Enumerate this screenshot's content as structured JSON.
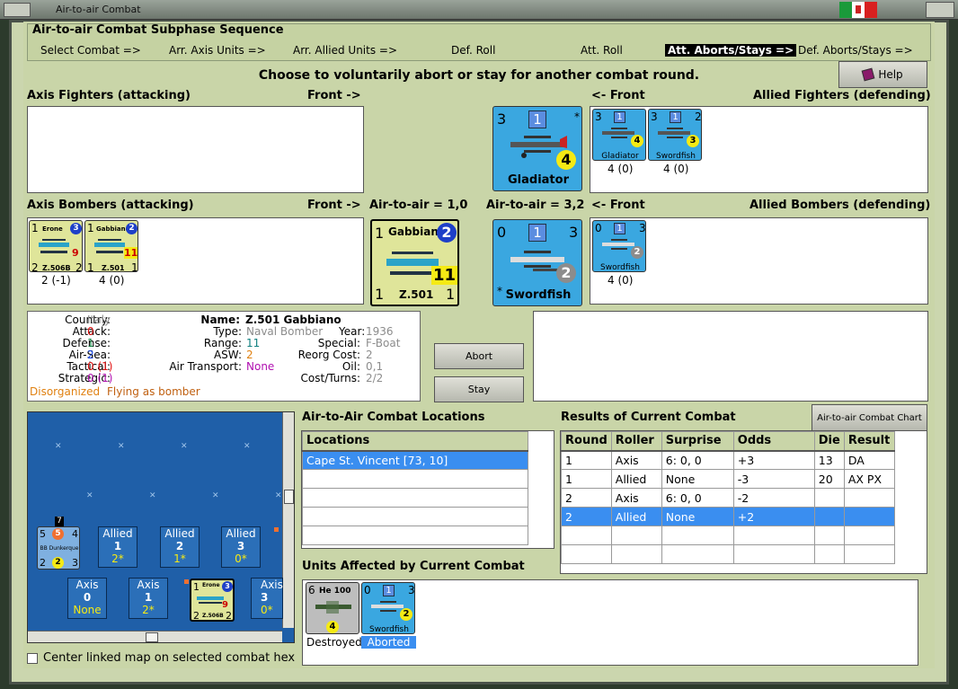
{
  "window": {
    "title": "Air-to-air Combat"
  },
  "phase": {
    "title": "Air-to-air Combat Subphase Sequence",
    "steps": [
      "Select Combat =>",
      "Arr. Axis Units =>",
      "Arr. Allied Units =>",
      "Def. Roll",
      "Att. Roll",
      "Att. Aborts/Stays =>",
      "Def. Aborts/Stays =>"
    ],
    "active_index": 5
  },
  "instruction": "Choose to voluntarily abort or stay for another combat round.",
  "help_label": "Help",
  "labels": {
    "axis_fighters": "Axis Fighters (attacking)",
    "front_right": "Front ->",
    "front_left": "<- Front",
    "allied_fighters": "Allied Fighters (defending)",
    "axis_bombers": "Axis Bombers (attacking)",
    "allied_bombers": "Allied Bombers (defending)",
    "air_axis": "Air-to-air = 1,0",
    "air_allied": "Air-to-air = 3,2"
  },
  "units": {
    "gladiator_big": {
      "att": "3",
      "def": "1",
      "val": "4",
      "name": "Gladiator",
      "star": "*"
    },
    "gladiator_small": {
      "att": "3",
      "def": "1",
      "val": "4",
      "name": "Gladiator",
      "status": "4 (0)"
    },
    "swordfish_fighter_small": {
      "att": "3",
      "def": "1",
      "top": "2",
      "val": "3",
      "name": "Swordfish",
      "status": "4 (0)"
    },
    "erone": {
      "name": "Erone",
      "model": "Z.506B",
      "l1": "1",
      "l2": "2",
      "r2": "2",
      "circ": "3",
      "val": "9",
      "status": "2 (-1)"
    },
    "gabbiano_small": {
      "name": "Gabbiano",
      "model": "Z.501",
      "l1": "1",
      "l2": "1",
      "r2": "1",
      "circ": "2",
      "val": "11",
      "status": "4 (0)"
    },
    "gabbiano_big": {
      "name": "Gabbiano",
      "model": "Z.501",
      "l1": "1",
      "l2": "1",
      "r2": "1",
      "circ": "2",
      "val": "11"
    },
    "swordfish_big": {
      "att": "0",
      "def": "1",
      "top": "3",
      "val": "2",
      "name": "Swordfish",
      "star": "*"
    },
    "swordfish_bomber_small": {
      "att": "0",
      "def": "1",
      "top": "3",
      "val": "2",
      "name": "Swordfish",
      "status": "4 (0)"
    }
  },
  "info": {
    "country_label": "Country:",
    "country": "Italy",
    "attack_label": "Attack:",
    "attack": "0",
    "defense_label": "Defense:",
    "defense": "1",
    "airsea_label": "Air-Sea:",
    "airsea": "2",
    "tactical_label": "Tactical:",
    "tactical": "0 (1)",
    "strategic_label": "Strategic:",
    "strategic": "0 (1)",
    "status_a": "Disorganized",
    "status_b": "Flying as bomber",
    "name_label": "Name:",
    "name": "Z.501 Gabbiano",
    "type_label": "Type:",
    "type": "Naval Bomber",
    "year_label": "Year:",
    "year": "1936",
    "range_label": "Range:",
    "range": "11",
    "special_label": "Special:",
    "special": "F-Boat",
    "asw_label": "ASW:",
    "asw": "2",
    "reorg_label": "Reorg Cost:",
    "reorg": "2",
    "airtransport_label": "Air Transport:",
    "airtransport": "None",
    "oil_label": "Oil:",
    "oil": "0,1",
    "costturns_label": "Cost/Turns:",
    "costturns": "2/2"
  },
  "buttons": {
    "abort": "Abort",
    "stay": "Stay",
    "chart": "Air-to-air Combat Chart"
  },
  "map": {
    "ship": {
      "top": "7",
      "l": "5",
      "c": "5",
      "r": "4",
      "name": "BB Dunkerque",
      "b1": "2",
      "b2": "2",
      "b3": "3"
    },
    "allied_boxes": [
      {
        "side": "Allied",
        "n": "1",
        "v": "2*"
      },
      {
        "side": "Allied",
        "n": "2",
        "v": "1*"
      },
      {
        "side": "Allied",
        "n": "3",
        "v": "0*"
      }
    ],
    "axis_boxes": [
      {
        "side": "Axis",
        "n": "0",
        "v": "None"
      },
      {
        "side": "Axis",
        "n": "1",
        "v": "2*"
      },
      {
        "side": "Axis",
        "n": "3",
        "v": "0*"
      }
    ],
    "erone": {
      "name": "Erone",
      "model": "Z.506B",
      "l1": "1",
      "l2": "2",
      "r2": "2",
      "circ": "3",
      "val": "9"
    }
  },
  "center_linked": "Center linked map on selected combat hex",
  "locations": {
    "title": "Air-to-Air Combat Locations",
    "header": "Locations",
    "rows": [
      "Cape St. Vincent [73, 10]"
    ]
  },
  "results": {
    "title": "Results of Current Combat",
    "headers": [
      "Round",
      "Roller",
      "Surprise",
      "Odds",
      "Die",
      "Result"
    ],
    "rows": [
      [
        "1",
        "Axis",
        "6: 0, 0",
        "+3",
        "13",
        "DA"
      ],
      [
        "1",
        "Allied",
        "None",
        "-3",
        "20",
        "AX PX"
      ],
      [
        "2",
        "Axis",
        "6: 0, 0",
        "-2",
        "",
        ""
      ],
      [
        "2",
        "Allied",
        "None",
        "+2",
        "",
        ""
      ]
    ],
    "selected": 3
  },
  "affected": {
    "title": "Units Affected by Current Combat",
    "units": [
      {
        "name": "He 100",
        "att": "6",
        "val": "4",
        "caption": "Destroyed"
      },
      {
        "name": "Swordfish",
        "att": "0",
        "def": "1",
        "top": "3",
        "val": "2",
        "caption": "Aborted"
      }
    ]
  },
  "colors": {
    "accent": "#3a8ef0",
    "unit_blue": "#3aa7e0",
    "unit_green": "#dfe59a",
    "panel": "#c9d5a8"
  }
}
